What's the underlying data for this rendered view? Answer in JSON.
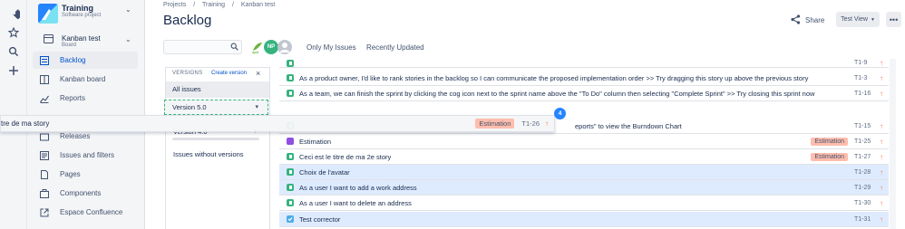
{
  "global_nav": {
    "icons": [
      "jira-logo-icon",
      "star-icon",
      "search-icon",
      "create-plus-icon"
    ]
  },
  "project": {
    "name": "Training",
    "type": "Software project"
  },
  "board": {
    "name": "Kanban test",
    "type": "Board"
  },
  "sidebar": {
    "items": [
      {
        "label": "Backlog",
        "icon": "backlog-icon",
        "active": true
      },
      {
        "label": "Kanban board",
        "icon": "board-icon",
        "active": false
      },
      {
        "label": "Reports",
        "icon": "reports-icon",
        "active": false
      },
      {
        "label": "Releases",
        "icon": "releases-icon",
        "active": false
      },
      {
        "label": "Issues and filters",
        "icon": "issues-icon",
        "active": false
      },
      {
        "label": "Pages",
        "icon": "pages-icon",
        "active": false
      },
      {
        "label": "Components",
        "icon": "components-icon",
        "active": false
      },
      {
        "label": "Espace Confluence",
        "icon": "confluence-icon",
        "active": false
      }
    ]
  },
  "breadcrumbs": [
    "Projects",
    "/",
    "Training",
    "/",
    "Kanban test"
  ],
  "page": {
    "title": "Backlog",
    "share_label": "Share",
    "view_label": "Test View",
    "more_label": "•••"
  },
  "filters": {
    "search_placeholder": "",
    "avatars": [
      "spring",
      "NP",
      "user"
    ],
    "quick_filters": [
      "Only My Issues",
      "Recently Updated"
    ]
  },
  "versions": {
    "header": "VERSIONS",
    "create_label": "Create version",
    "close_label": "×",
    "all_label": "All issues",
    "items": [
      {
        "label": "Version 5.0"
      },
      {
        "label": "Version 4.0"
      }
    ],
    "without_label": "Issues without versions"
  },
  "issues": [
    {
      "type": "story",
      "summary": "",
      "epic": "",
      "key": "T1-9",
      "selected": false
    },
    {
      "type": "story",
      "summary": "As a product owner, I'd like to rank stories in the backlog so I can communicate the proposed implementation order >> Try dragging this story up above the previous story",
      "epic": "",
      "key": "T1-3",
      "selected": false
    },
    {
      "type": "story",
      "summary": "As a team, we can finish the sprint by clicking the cog icon next to the sprint name above the \"To Do\" column then selecting \"Complete Sprint\" >> Try closing this sprint now",
      "epic": "",
      "key": "T1-16",
      "selected": false
    },
    {
      "type": "story",
      "summary": "eports\" to view the Burndown Chart",
      "epic": "",
      "key": "T1-15",
      "selected": false
    },
    {
      "type": "epic",
      "summary": "Estimation",
      "epic": "Estimation",
      "key": "T1-25",
      "selected": false
    },
    {
      "type": "story",
      "summary": "Ceci est le titre de ma 2e story",
      "epic": "Estimation",
      "key": "T1-27",
      "selected": false
    },
    {
      "type": "story",
      "summary": "Choix de l'avatar",
      "epic": "",
      "key": "T1-28",
      "selected": true
    },
    {
      "type": "story",
      "summary": "As a user I want to add a work address",
      "epic": "",
      "key": "T1-29",
      "selected": true
    },
    {
      "type": "story",
      "summary": "As a user I want to delete an address",
      "epic": "",
      "key": "T1-30",
      "selected": false
    },
    {
      "type": "task",
      "summary": "Test corrector",
      "epic": "",
      "key": "T1-31",
      "selected": true
    }
  ],
  "drag": {
    "summary": "tre de ma story",
    "epic": "Estimation",
    "key": "T1-26",
    "count": "4"
  },
  "colors": {
    "accent": "#0052cc",
    "story": "#36b37e",
    "epic_type": "#904ee2",
    "epic_label": "#ffbdad",
    "selected_row": "#deebff",
    "priority": "#ff7452"
  }
}
